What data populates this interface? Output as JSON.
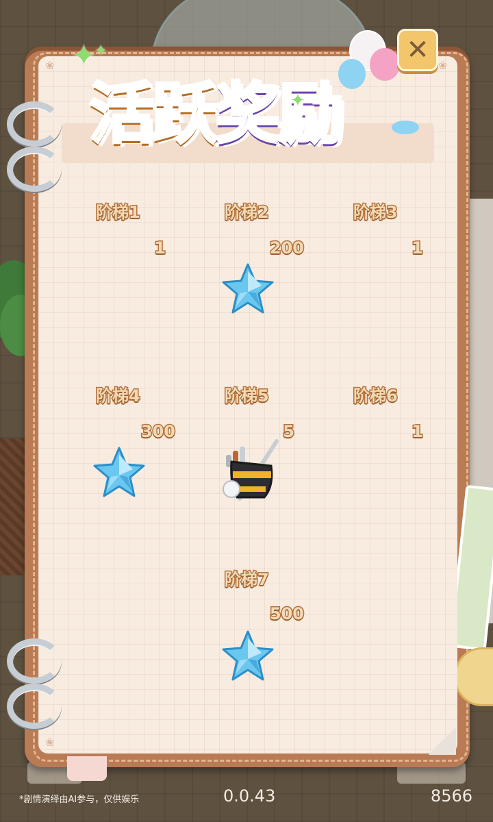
{
  "title": {
    "part1": "活跃",
    "part2": "奖励"
  },
  "close_label": "✕",
  "tiers": [
    {
      "label": "阶梯1",
      "count": "1",
      "reward_icon": "none"
    },
    {
      "label": "阶梯2",
      "count": "200",
      "reward_icon": "blue-star-icon"
    },
    {
      "label": "阶梯3",
      "count": "1",
      "reward_icon": "none"
    },
    {
      "label": "阶梯4",
      "count": "300",
      "reward_icon": "blue-star-icon"
    },
    {
      "label": "阶梯5",
      "count": "5",
      "reward_icon": "golf-bag-icon"
    },
    {
      "label": "阶梯6",
      "count": "1",
      "reward_icon": "none"
    },
    {
      "label": "阶梯7",
      "count": "500",
      "reward_icon": "blue-star-icon"
    }
  ],
  "footer": {
    "note": "*剧情演绎由AI参与，仅供娱乐",
    "version": "0.0.43",
    "score": "8566"
  },
  "colors": {
    "title_orange": "#f0a43a",
    "title_purple": "#a874e4",
    "label_fill": "#f2d9b5",
    "label_stroke": "#b5733d",
    "page_bg": "#f8ebe0",
    "book_brown": "#b97b54"
  }
}
